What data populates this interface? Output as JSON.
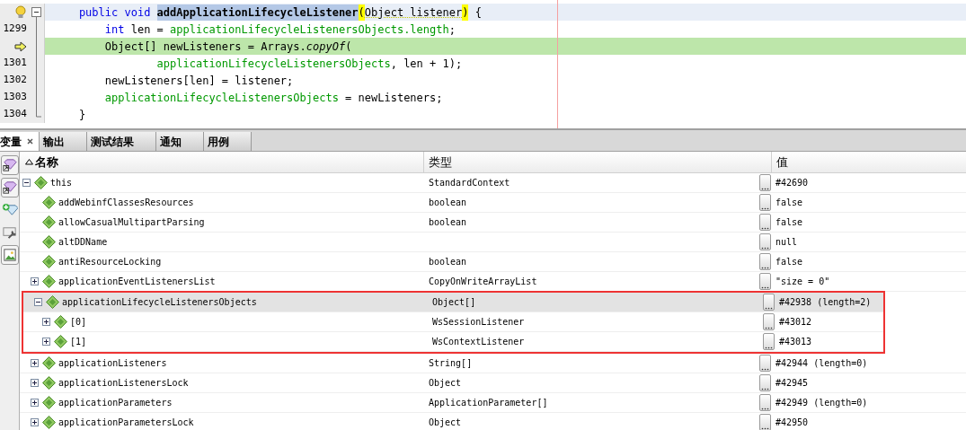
{
  "editor": {
    "lines": [
      {
        "gutter": {
          "kind": "hint"
        },
        "kind": "fold-start",
        "caret_line": true,
        "execution_point": false,
        "tokens": [
          {
            "kind": "keyword",
            "text": "    public void "
          },
          {
            "kind": "method",
            "text": "addApplicationLifecycleListener"
          },
          {
            "kind": "brace",
            "text": "("
          },
          {
            "kind": "param",
            "text": "Object listener"
          },
          {
            "kind": "brace",
            "text": ")"
          },
          {
            "kind": "plain",
            "text": " {"
          }
        ]
      },
      {
        "gutter": {
          "kind": "number",
          "text": "1299"
        },
        "kind": "fold-middle",
        "caret_line": false,
        "execution_point": false,
        "tokens": [
          {
            "kind": "keyword",
            "text": "        int"
          },
          {
            "kind": "plain",
            "text": " len = "
          },
          {
            "kind": "field",
            "text": "applicationLifecycleListenersObjects.length"
          },
          {
            "kind": "plain",
            "text": ";"
          }
        ]
      },
      {
        "gutter": {
          "kind": "pc"
        },
        "kind": "fold-middle",
        "caret_line": false,
        "execution_point": true,
        "tokens": [
          {
            "kind": "plain",
            "text": "        Object[] newListeners = Arrays."
          },
          {
            "kind": "italic",
            "text": "copyOf"
          },
          {
            "kind": "plain",
            "text": "("
          }
        ]
      },
      {
        "gutter": {
          "kind": "number",
          "text": "1301"
        },
        "kind": "fold-middle",
        "caret_line": false,
        "execution_point": false,
        "tokens": [
          {
            "kind": "field",
            "text": "                applicationLifecycleListenersObjects"
          },
          {
            "kind": "plain",
            "text": ", len + 1);"
          }
        ]
      },
      {
        "gutter": {
          "kind": "number",
          "text": "1302"
        },
        "kind": "fold-middle",
        "caret_line": false,
        "execution_point": false,
        "tokens": [
          {
            "kind": "plain",
            "text": "        newListeners[len] = listener;"
          }
        ]
      },
      {
        "gutter": {
          "kind": "number",
          "text": "1303"
        },
        "kind": "fold-middle",
        "caret_line": false,
        "execution_point": false,
        "tokens": [
          {
            "kind": "field",
            "text": "        applicationLifecycleListenersObjects"
          },
          {
            "kind": "plain",
            "text": " = newListeners;"
          }
        ]
      },
      {
        "gutter": {
          "kind": "number",
          "text": "1304"
        },
        "kind": "fold-end",
        "caret_line": false,
        "execution_point": false,
        "tokens": [
          {
            "kind": "plain",
            "text": "    }"
          }
        ]
      }
    ]
  },
  "tabs": [
    {
      "label": "变量",
      "selected": true,
      "closable": true
    },
    {
      "label": "输出",
      "selected": false,
      "closable": false
    },
    {
      "label": "测试结果",
      "selected": false,
      "closable": false
    },
    {
      "label": "通知",
      "selected": false,
      "closable": false
    },
    {
      "label": "用例",
      "selected": false,
      "closable": false
    }
  ],
  "toolbar": [
    {
      "kind": "gem-arrow",
      "pressed": true
    },
    {
      "kind": "gem-arrow",
      "pressed": true
    },
    {
      "kind": "gem-plus",
      "pressed": false
    },
    {
      "kind": "wrench",
      "pressed": false
    },
    {
      "kind": "picture",
      "pressed": true
    }
  ],
  "variables": {
    "columns": [
      "名称",
      "类型",
      "值"
    ],
    "rows": [
      {
        "name": "this",
        "type": "StandardContext",
        "value": "#42690",
        "selected": false,
        "expanded": true,
        "children": [
          {
            "name": "addWebinfClassesResources",
            "type": "boolean",
            "value": "false",
            "selected": false
          },
          {
            "name": "allowCasualMultipartParsing",
            "type": "boolean",
            "value": "false",
            "selected": false
          },
          {
            "name": "altDDName",
            "value": "null",
            "selected": false
          },
          {
            "name": "antiResourceLocking",
            "type": "boolean",
            "value": "false",
            "selected": false
          },
          {
            "name": "applicationEventListenersList",
            "type": "CopyOnWriteArrayList",
            "value": "\"size = 0\"",
            "selected": false,
            "expanded": false
          },
          {
            "name": "applicationLifecycleListenersObjects",
            "type": "Object[]",
            "value": "#42938 (length=2)",
            "selected": true,
            "expanded": true,
            "annotated": true,
            "children": [
              {
                "name": "[0]",
                "type": "WsSessionListener",
                "value": "#43012",
                "selected": false,
                "expanded": false
              },
              {
                "name": "[1]",
                "type": "WsContextListener",
                "value": "#43013",
                "selected": false,
                "expanded": false
              }
            ]
          },
          {
            "name": "applicationListeners",
            "type": "String[]",
            "value": "#42944 (length=0)",
            "selected": false,
            "expanded": false
          },
          {
            "name": "applicationListenersLock",
            "type": "Object",
            "value": "#42945",
            "selected": false,
            "expanded": false
          },
          {
            "name": "applicationParameters",
            "type": "ApplicationParameter[]",
            "value": "#42949 (length=0)",
            "selected": false,
            "expanded": false
          },
          {
            "name": "applicationParametersLock",
            "type": "Object",
            "value": "#42950",
            "selected": false,
            "expanded": false
          }
        ]
      }
    ]
  }
}
